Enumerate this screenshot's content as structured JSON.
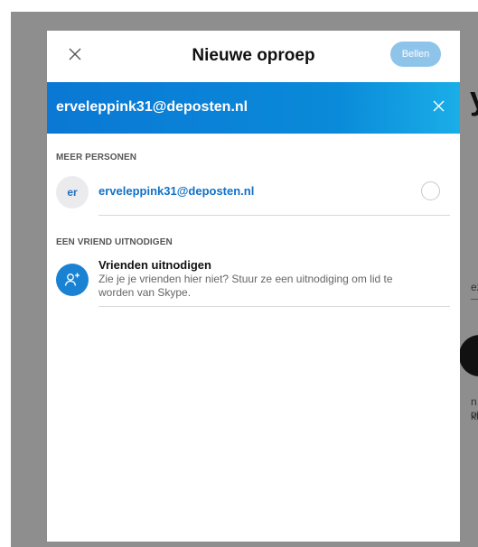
{
  "background_page": {
    "title_fragment": "y",
    "fragment_1": "ezi",
    "fragment_2": "n of",
    "fragment_3": "kba"
  },
  "dialog": {
    "title": "Nieuwe oproep",
    "close_icon": "close-icon",
    "call_button_label": "Bellen",
    "selected_banner": {
      "text": "erveleppink31@deposten.nl",
      "remove_icon": "close-icon"
    },
    "more_people": {
      "section_label": "MEER PERSONEN",
      "contacts": [
        {
          "avatar_initials": "er",
          "name": "erveleppink31@deposten.nl",
          "selected": false
        }
      ]
    },
    "invite_friend": {
      "section_label": "EEN VRIEND UITNODIGEN",
      "icon": "add-person-icon",
      "title": "Vrienden uitnodigen",
      "description": "Zie je je vrienden hier niet? Stuur ze een uitnodiging om lid te worden van Skype."
    }
  },
  "colors": {
    "accent": "#0a78d4",
    "call_button_disabled": "#8fc4ea",
    "overlay": "#8e8e8e"
  }
}
